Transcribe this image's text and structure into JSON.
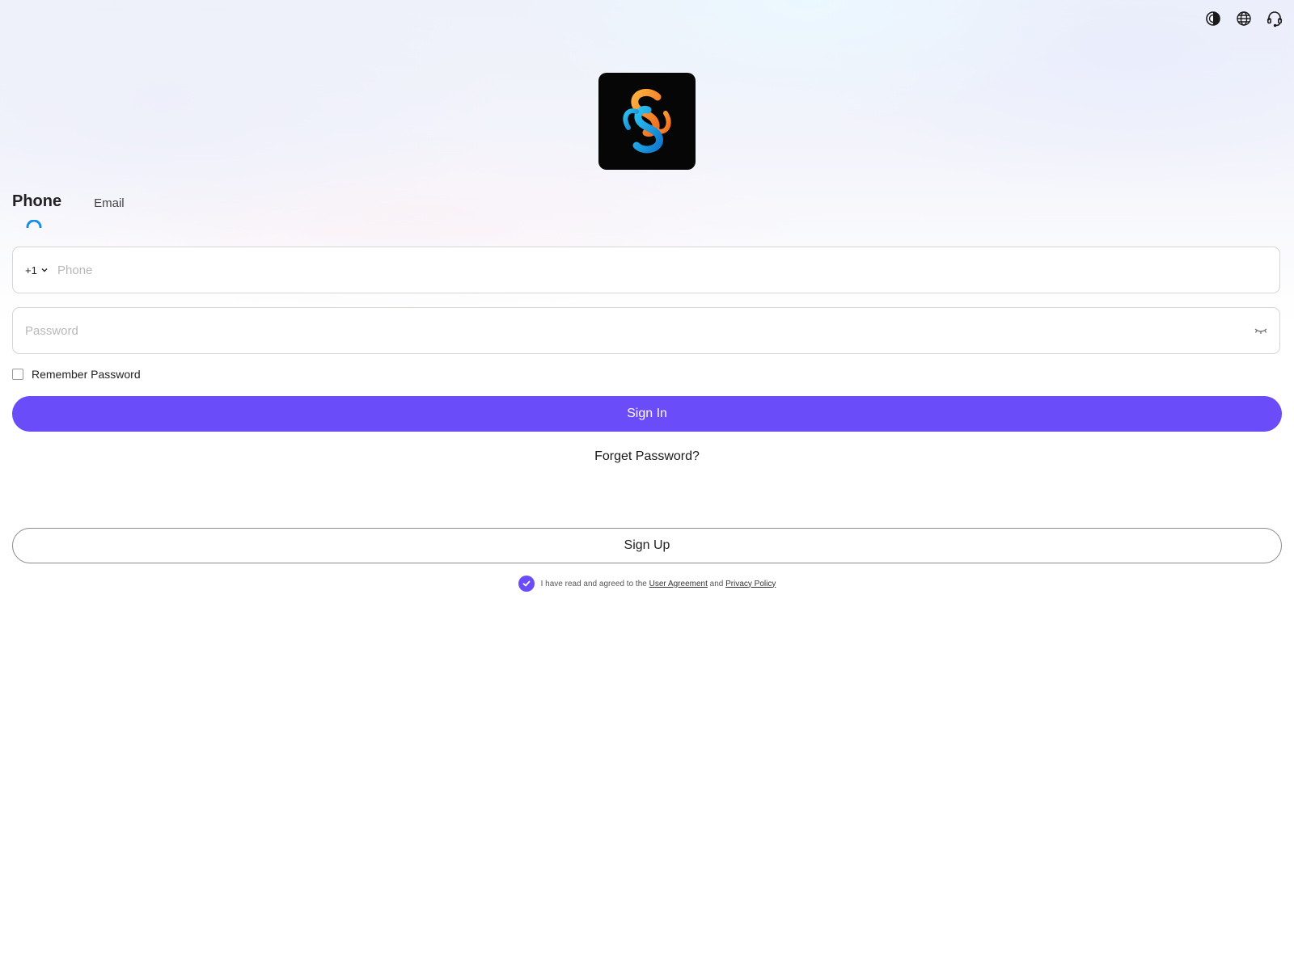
{
  "header": {
    "icons": [
      "theme-contrast-icon",
      "globe-language-icon",
      "headset-support-icon"
    ]
  },
  "logo": {
    "colors": {
      "background": "#060606",
      "gradient_orange": "#f7941d",
      "gradient_blue": "#1aa3e8"
    }
  },
  "tabs": [
    {
      "label": "Phone",
      "active": true
    },
    {
      "label": "Email",
      "active": false
    }
  ],
  "form": {
    "country_code": "+1",
    "phone_placeholder": "Phone",
    "password_placeholder": "Password",
    "remember_label": "Remember Password",
    "remember_checked": false,
    "sign_in_label": "Sign In",
    "forget_label": "Forget Password?",
    "sign_up_label": "Sign Up"
  },
  "agreement": {
    "checked": true,
    "prefix": "I have read and agreed to the",
    "user_agreement": "User Agreement",
    "conjunction": "and",
    "privacy_policy": "Privacy Policy"
  },
  "colors": {
    "accent": "#6a4cf8",
    "tab_indicator": "#1b8fe8"
  }
}
